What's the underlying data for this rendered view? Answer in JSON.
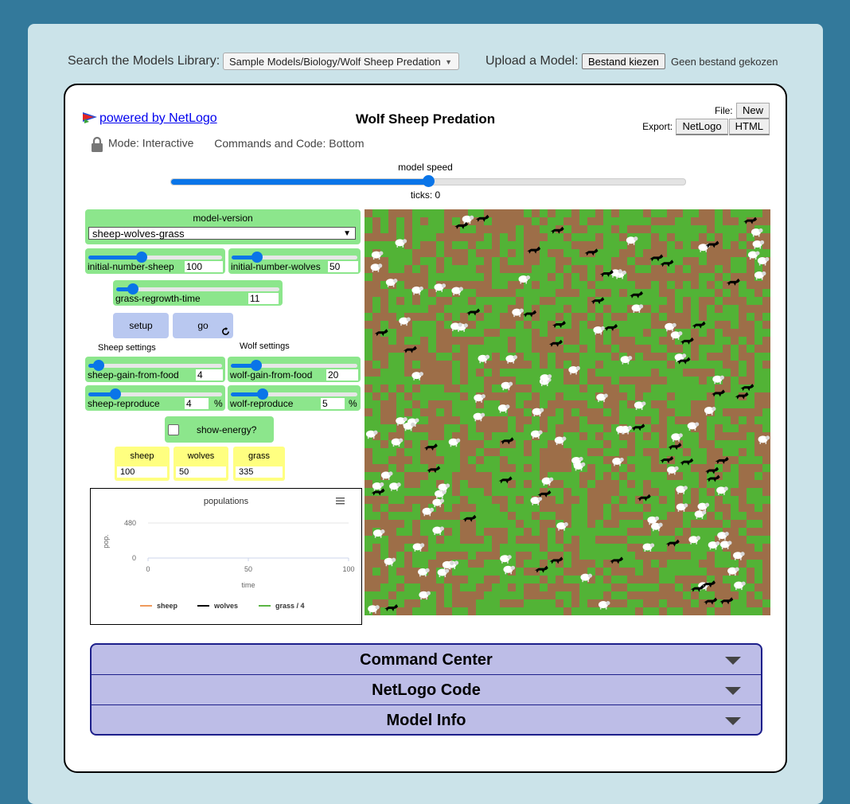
{
  "topbar": {
    "search_label": "Search the Models Library:",
    "search_value": "Sample Models/Biology/Wolf Sheep Predation",
    "upload_label": "Upload a Model:",
    "file_button": "Bestand kiezen",
    "file_status": "Geen bestand gekozen"
  },
  "header": {
    "powered_by": "powered by NetLogo",
    "title": "Wolf Sheep Predation",
    "file_label": "File:",
    "file_new": "New",
    "export_label": "Export:",
    "export_netlogo": "NetLogo",
    "export_html": "HTML",
    "mode": "Mode: Interactive",
    "commands_code": "Commands and Code: Bottom"
  },
  "speed": {
    "label": "model speed",
    "fraction": 0.5,
    "ticks": "ticks: 0"
  },
  "widgets": {
    "model_version": {
      "label": "model-version",
      "value": "sheep-wolves-grass"
    },
    "sliders": {
      "initial_sheep": {
        "name": "initial-number-sheep",
        "value": "100",
        "fraction": 0.4,
        "unit": ""
      },
      "initial_wolves": {
        "name": "initial-number-wolves",
        "value": "50",
        "fraction": 0.2,
        "unit": ""
      },
      "grass_regrowth": {
        "name": "grass-regrowth-time",
        "value": "11",
        "fraction": 0.1,
        "unit": ""
      },
      "sheep_gain": {
        "name": "sheep-gain-from-food",
        "value": "4",
        "fraction": 0.08,
        "unit": ""
      },
      "wolf_gain": {
        "name": "wolf-gain-from-food",
        "value": "20",
        "fraction": 0.2,
        "unit": ""
      },
      "sheep_reproduce": {
        "name": "sheep-reproduce",
        "value": "4",
        "fraction": 0.2,
        "unit": "%"
      },
      "wolf_reproduce": {
        "name": "wolf-reproduce",
        "value": "5",
        "fraction": 0.25,
        "unit": "%"
      }
    },
    "setup_label": "setup",
    "go_label": "go",
    "sheep_settings": "Sheep settings",
    "wolf_settings": "Wolf settings",
    "show_energy": "show-energy?",
    "monitors": {
      "sheep": {
        "label": "sheep",
        "value": "100"
      },
      "wolves": {
        "label": "wolves",
        "value": "50"
      },
      "grass": {
        "label": "grass",
        "value": "335"
      }
    }
  },
  "chart_data": {
    "type": "line",
    "title": "populations",
    "xlabel": "time",
    "ylabel": "pop.",
    "xlim": [
      0,
      100
    ],
    "ylim": [
      0,
      480
    ],
    "xticks": [
      "0",
      "50",
      "100"
    ],
    "yticks": [
      "480",
      "0"
    ],
    "legend_position": "bottom",
    "series": [
      {
        "name": "sheep",
        "color": "#ef9a5c",
        "values": []
      },
      {
        "name": "wolves",
        "color": "#000000",
        "values": []
      },
      {
        "name": "grass / 4",
        "color": "#5ab544",
        "values": []
      }
    ]
  },
  "view": {
    "grass_color": "#52b336",
    "dirt_color": "#9d6e48",
    "sheep_color": "#ffffff",
    "wolf_color": "#000000",
    "sheep_count": 100,
    "wolf_count": 50
  },
  "accordion": {
    "command_center": "Command Center",
    "netlogo_code": "NetLogo Code",
    "model_info": "Model Info"
  }
}
